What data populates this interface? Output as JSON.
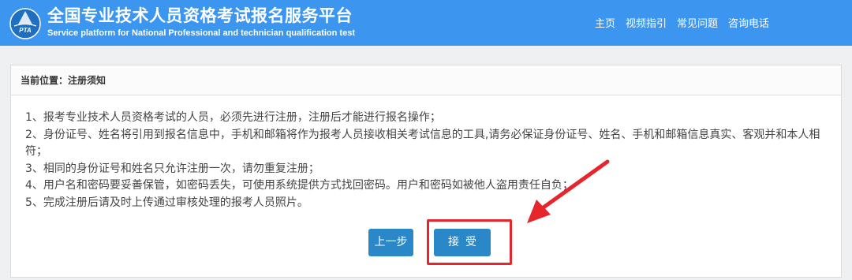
{
  "header": {
    "title": "全国专业技术人员资格考试报名服务平台",
    "subtitle": "Service platform for National Professional and technician qualification test",
    "logo_text": "PTA",
    "background": "#3c96f0",
    "nav": [
      {
        "label": "主页"
      },
      {
        "label": "视频指引"
      },
      {
        "label": "常见问题"
      },
      {
        "label": "咨询电话"
      }
    ]
  },
  "breadcrumb": {
    "text": "当前位置：注册须知"
  },
  "notice": {
    "items": [
      "1、报考专业技术人员资格考试的人员，必须先进行注册，注册后才能进行报名操作；",
      "2、身份证号、姓名将引用到报名信息中，手机和邮箱将作为报考人员接收相关考试信息的工具,请务必保证身份证号、姓名、手机和邮箱信息真实、客观并和本人相符；",
      "3、相同的身份证号和姓名只允许注册一次，请勿重复注册；",
      "4、用户名和密码要妥善保管，如密码丢失，可使用系统提供方式找回密码。用户和密码如被他人盗用责任自负；",
      "5、完成注册后请及时上传通过审核处理的报考人员照片。"
    ]
  },
  "buttons": {
    "prev_label": "上一步",
    "accept_label": "接受",
    "color": "#2a88c9"
  },
  "annotation": {
    "highlight_color": "#e6262d"
  }
}
